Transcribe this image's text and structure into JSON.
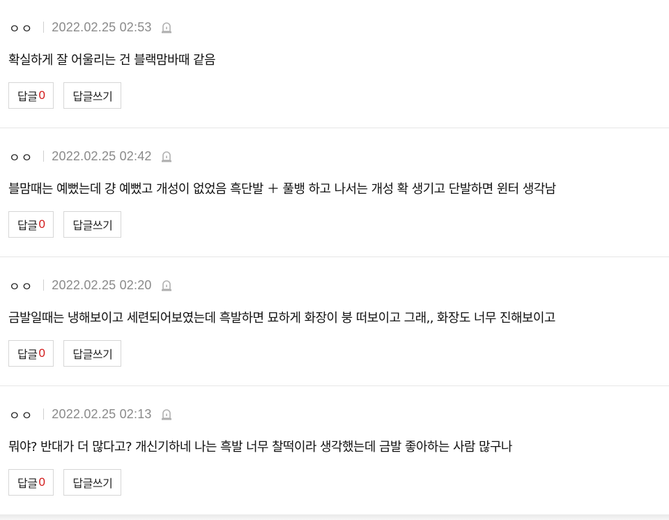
{
  "comments": [
    {
      "author": "ㅇㅇ",
      "date": "2022.02.25 02:53",
      "text": "확실하게 잘 어울리는 건 블랙맘바때 같음",
      "reply_label": "답글",
      "reply_count": "0",
      "write_reply_label": "답글쓰기"
    },
    {
      "author": "ㅇㅇ",
      "date": "2022.02.25 02:42",
      "text": "블맘때는 예뻤는데 걍 예뻤고 개성이 없었음 흑단발 ＋ 풀뱅 하고 나서는 개성 확 생기고 단발하면 윈터 생각남",
      "reply_label": "답글",
      "reply_count": "0",
      "write_reply_label": "답글쓰기"
    },
    {
      "author": "ㅇㅇ",
      "date": "2022.02.25 02:20",
      "text": "금발일때는 냉해보이고 세련되어보였는데 흑발하면 묘하게 화장이 붕 떠보이고 그래,, 화장도 너무 진해보이고",
      "reply_label": "답글",
      "reply_count": "0",
      "write_reply_label": "답글쓰기"
    },
    {
      "author": "ㅇㅇ",
      "date": "2022.02.25 02:13",
      "text": "뭐야? 반대가 더 많다고? 개신기하네 나는 흑발 너무 찰떡이라 생각했는데 금발 좋아하는 사람 많구나",
      "reply_label": "답글",
      "reply_count": "0",
      "write_reply_label": "답글쓰기"
    }
  ],
  "icons": {
    "report": "siren-report-icon"
  },
  "colors": {
    "reply_count": "#d21a1a",
    "date": "#8a8a8a",
    "border": "#d6d6d6"
  }
}
